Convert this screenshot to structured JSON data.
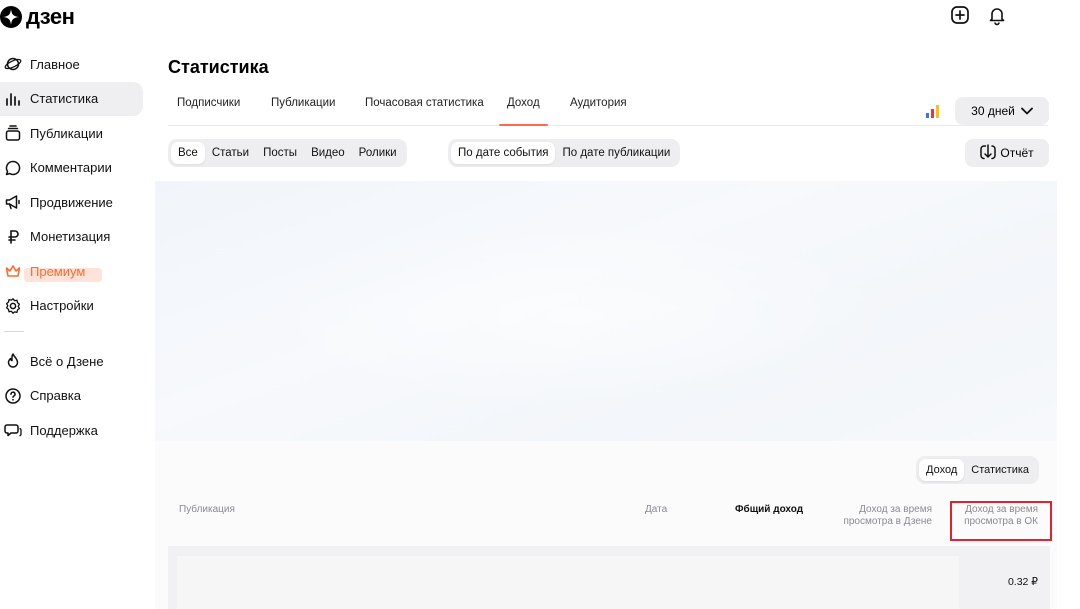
{
  "app": {
    "logo_text": "дзен"
  },
  "sidebar": {
    "items": [
      {
        "label": "Главное",
        "icon": "planet-icon"
      },
      {
        "label": "Статистика",
        "icon": "bar-chart-icon"
      },
      {
        "label": "Публикации",
        "icon": "stack-icon"
      },
      {
        "label": "Комментарии",
        "icon": "comment-icon"
      },
      {
        "label": "Продвижение",
        "icon": "megaphone-icon"
      },
      {
        "label": "Монетизация",
        "icon": "ruble-icon"
      },
      {
        "label": "Премиум",
        "icon": "crown-icon"
      },
      {
        "label": "Настройки",
        "icon": "gear-icon"
      }
    ],
    "footer_items": [
      {
        "label": "Всё о Дзене",
        "icon": "flame-icon"
      },
      {
        "label": "Справка",
        "icon": "help-icon"
      },
      {
        "label": "Поддержка",
        "icon": "support-chat-icon"
      }
    ]
  },
  "main": {
    "title": "Статистика",
    "tabs": [
      "Подписчики",
      "Публикации",
      "Почасовая статистика",
      "Доход",
      "Аудитория"
    ],
    "active_tab": "Доход",
    "period": "30 дней",
    "content_filter": [
      "Все",
      "Статьи",
      "Посты",
      "Видео",
      "Ролики"
    ],
    "date_filter": [
      "По дате события",
      "По дате публикации"
    ],
    "report_label": "Отчёт",
    "view_toggle": [
      "Доход",
      "Статистика"
    ],
    "table": {
      "headers": {
        "publication": "Публикация",
        "date": "Дата",
        "total": "Фбщий доход",
        "dzen_l1": "Доход за время",
        "dzen_l2": "просмотра в Дзене",
        "ok_l1": "Доход за время",
        "ok_l2": "просмотра в ОК"
      },
      "rows": [
        {
          "value": "0.32 ₽"
        }
      ]
    }
  },
  "colors": {
    "accent": "#ff6b4a",
    "premium": "#ff6b2c",
    "highlight": "#e0232f"
  }
}
